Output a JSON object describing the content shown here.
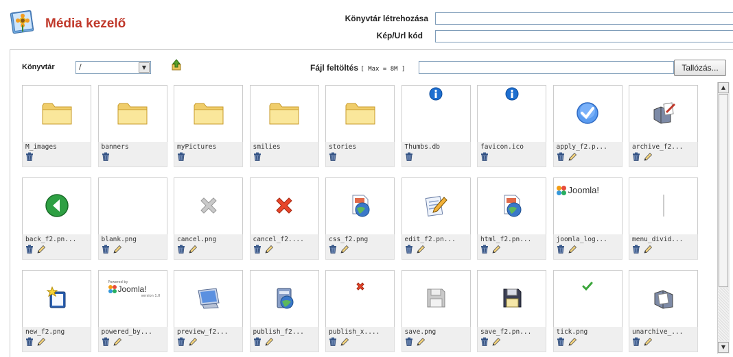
{
  "header": {
    "title": "Média kezelő",
    "create_dir_label": "Könyvtár létrehozása",
    "create_dir_value": "",
    "code_label": "Kép/Url kód",
    "code_value": ""
  },
  "toolbar": {
    "dir_label": "Könyvtár",
    "dir_value": "/",
    "upload_label": "Fájl feltöltés",
    "upload_hint": "[ Max = 8M ]",
    "upload_value": "",
    "browse_label": "Tallózás..."
  },
  "files": [
    {
      "name": "M_images",
      "icon": "folder-icon",
      "editable": false
    },
    {
      "name": "banners",
      "icon": "folder-icon",
      "editable": false
    },
    {
      "name": "myPictures",
      "icon": "folder-icon",
      "editable": false
    },
    {
      "name": "smilies",
      "icon": "folder-icon",
      "editable": false
    },
    {
      "name": "stories",
      "icon": "folder-icon",
      "editable": false
    },
    {
      "name": "Thumbs.db",
      "icon": "info-icon",
      "editable": false
    },
    {
      "name": "favicon.ico",
      "icon": "info-icon",
      "editable": false
    },
    {
      "name": "apply_f2.p...",
      "icon": "apply-check-icon",
      "editable": true
    },
    {
      "name": "archive_f2...",
      "icon": "archive-icon",
      "editable": true
    },
    {
      "name": "back_f2.pn...",
      "icon": "back-arrow-icon",
      "editable": true
    },
    {
      "name": "blank.png",
      "icon": "blank-icon",
      "editable": true
    },
    {
      "name": "cancel.png",
      "icon": "cancel-grey-icon",
      "editable": true
    },
    {
      "name": "cancel_f2....",
      "icon": "cancel-red-icon",
      "editable": true
    },
    {
      "name": "css_f2.png",
      "icon": "css-globe-icon",
      "editable": true
    },
    {
      "name": "edit_f2.pn...",
      "icon": "edit-icon",
      "editable": true
    },
    {
      "name": "html_f2.pn...",
      "icon": "html-globe-icon",
      "editable": true
    },
    {
      "name": "joomla_log...",
      "icon": "joomla-logo-icon",
      "editable": true
    },
    {
      "name": "menu_divid...",
      "icon": "menu-divider-icon",
      "editable": true
    },
    {
      "name": "new_f2.png",
      "icon": "new-icon",
      "editable": true
    },
    {
      "name": "powered_by...",
      "icon": "powered-by-joomla-icon",
      "editable": true
    },
    {
      "name": "preview_f2...",
      "icon": "preview-monitor-icon",
      "editable": true
    },
    {
      "name": "publish_f2...",
      "icon": "publish-icon",
      "editable": true
    },
    {
      "name": "publish_x....",
      "icon": "publish-x-icon",
      "editable": true
    },
    {
      "name": "save.png",
      "icon": "save-grey-icon",
      "editable": true
    },
    {
      "name": "save_f2.pn...",
      "icon": "save-icon",
      "editable": true
    },
    {
      "name": "tick.png",
      "icon": "tick-icon",
      "editable": true
    },
    {
      "name": "unarchive_...",
      "icon": "unarchive-icon",
      "editable": true
    }
  ],
  "logo_text": {
    "joomla": "Joomla!",
    "powered": "Powered by",
    "version": "version 1.0"
  },
  "colors": {
    "title": "#c0392b",
    "folder": "#f5dc83",
    "info_blue": "#1e6fd0",
    "cancel_red": "#e8452a",
    "back_green": "#2ea043"
  }
}
